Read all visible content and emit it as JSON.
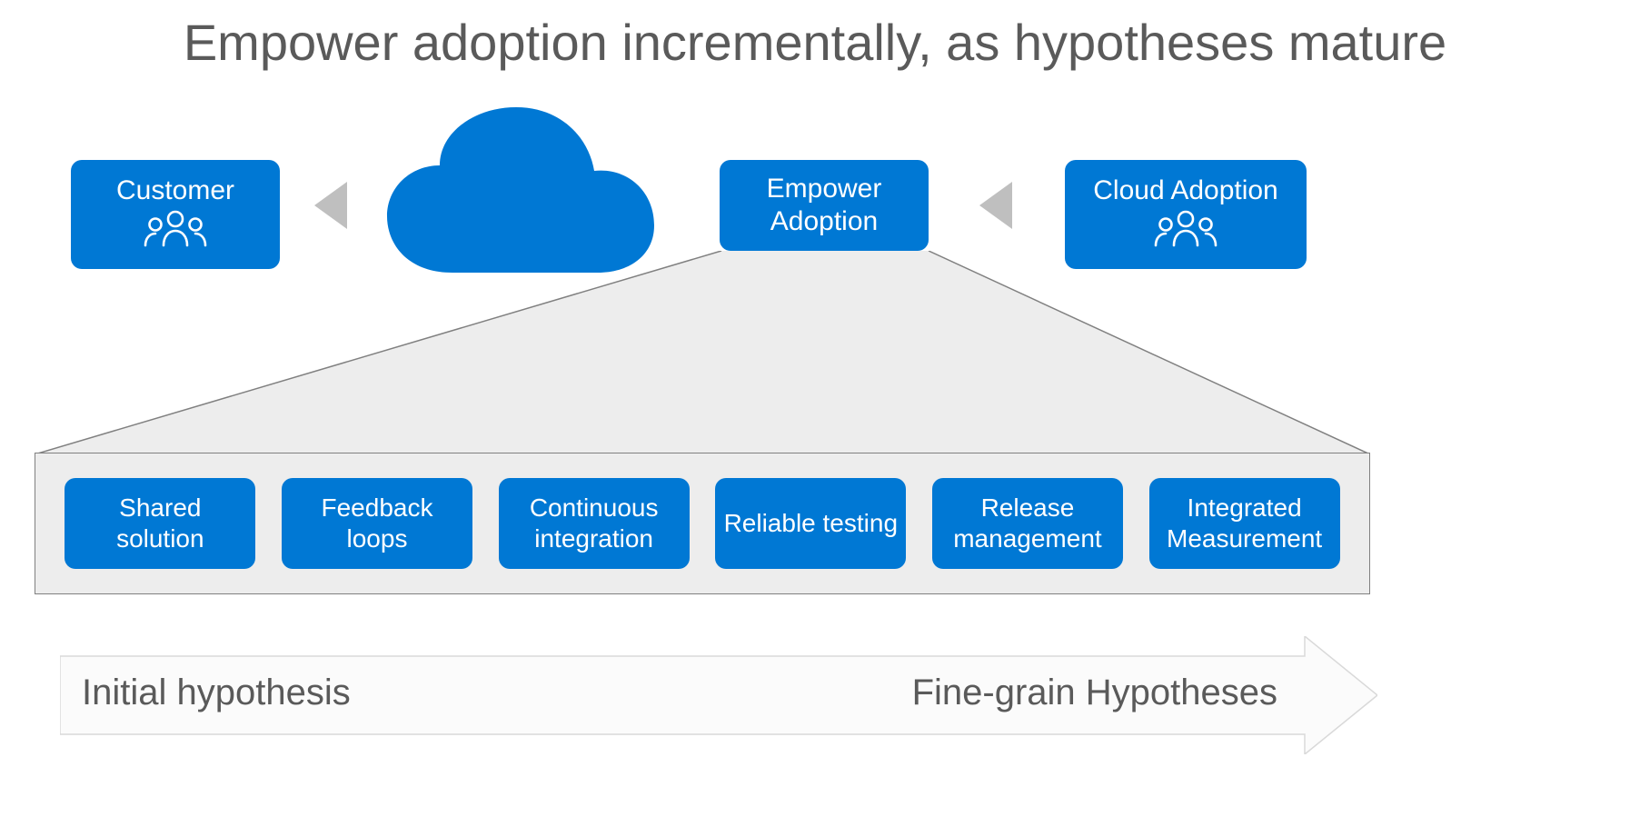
{
  "title": "Empower adoption incrementally, as hypotheses mature",
  "flow": {
    "customer": "Customer",
    "empower": "Empower\nAdoption",
    "cloud_adoption": "Cloud Adoption"
  },
  "details": [
    "Shared solution",
    "Feedback loops",
    "Continuous integration",
    "Reliable testing",
    "Release management",
    "Integrated Measurement"
  ],
  "spectrum": {
    "left": "Initial hypothesis",
    "right": "Fine-grain Hypotheses"
  },
  "colors": {
    "accent": "#0078d4",
    "grey_fill": "#ededed",
    "grey_border": "#808080",
    "arrow_grey": "#bfbfbf",
    "text_grey": "#5a5a5a"
  }
}
